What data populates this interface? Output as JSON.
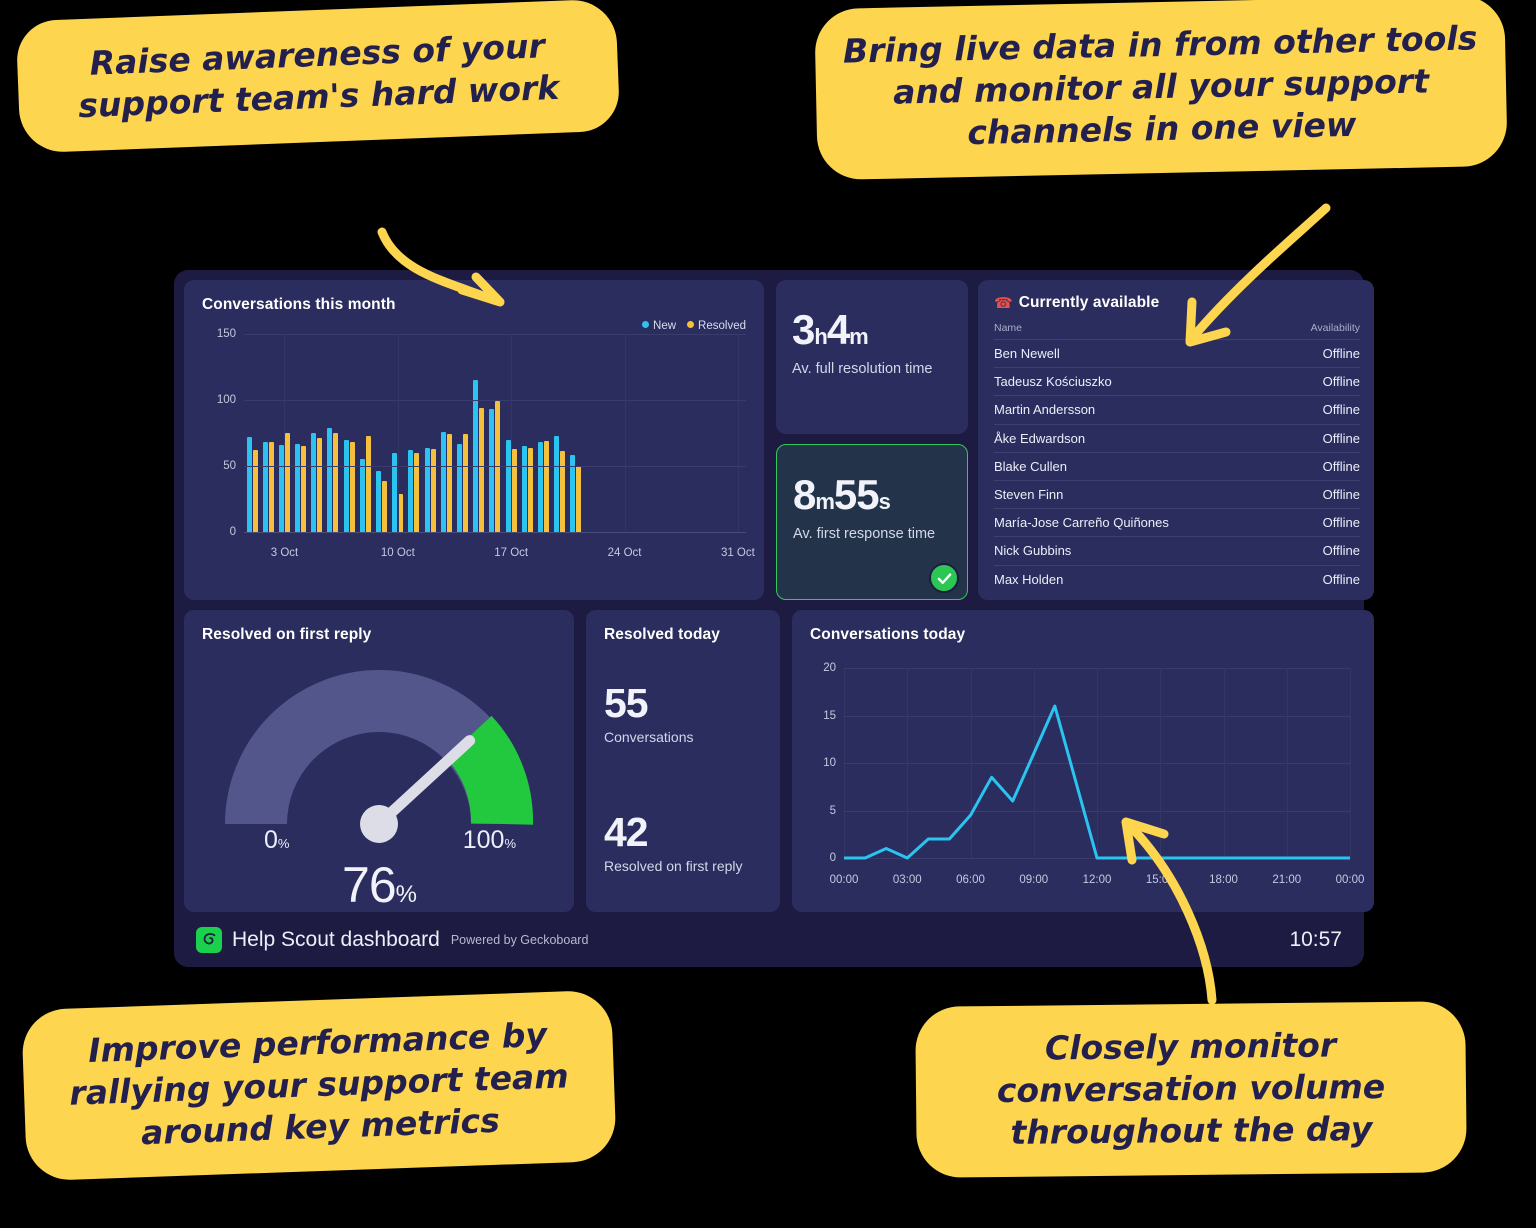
{
  "callouts": [
    {
      "id": "top-left",
      "text": "Raise awareness of your support team's hard work"
    },
    {
      "id": "top-right",
      "text": "Bring live data in from other tools and monitor all your support channels in one view"
    },
    {
      "id": "bottom-left",
      "text": "Improve performance by rallying your support team around key metrics"
    },
    {
      "id": "bottom-right",
      "text": "Closely monitor conversation volume throughout the day"
    }
  ],
  "dashboard": {
    "footer": {
      "logo_icon": "help-scout-logo-icon",
      "title": "Help Scout dashboard",
      "powered_by": "Powered by Geckoboard",
      "clock": "10:57"
    },
    "panels": {
      "conversations_month": {
        "title": "Conversations this month"
      },
      "full_resolution": {
        "value_main": "3",
        "value_main_unit": "h",
        "value_sec": "4",
        "value_sec_unit": "m",
        "label": "Av. full resolution time"
      },
      "first_response": {
        "value_main": "8",
        "value_main_unit": "m",
        "value_sec": "55",
        "value_sec_unit": "s",
        "label": "Av. first response time",
        "status_icon": "check-circle-icon",
        "status_color": "#2bc653"
      },
      "currently_available": {
        "emoji": "☎",
        "title": "Currently available",
        "columns": [
          "Name",
          "Availability"
        ],
        "rows": [
          [
            "Ben Newell",
            "Offline"
          ],
          [
            "Tadeusz Kościuszko",
            "Offline"
          ],
          [
            "Martin Andersson",
            "Offline"
          ],
          [
            "Åke Edwardson",
            "Offline"
          ],
          [
            "Blake Cullen",
            "Offline"
          ],
          [
            "Steven Finn",
            "Offline"
          ],
          [
            "María-Jose Carreño Quiñones",
            "Offline"
          ],
          [
            "Nick Gubbins",
            "Offline"
          ],
          [
            "Max Holden",
            "Offline"
          ]
        ]
      },
      "resolved_first_reply": {
        "title": "Resolved on first reply",
        "min_label": "0",
        "min_unit": "%",
        "max_label": "100",
        "max_unit": "%",
        "value": "76",
        "value_unit": "%"
      },
      "resolved_today": {
        "title": "Resolved today",
        "metric1_value": "55",
        "metric1_label": "Conversations",
        "metric2_value": "42",
        "metric2_label": "Resolved on first reply"
      },
      "conversations_today": {
        "title": "Conversations today"
      }
    }
  },
  "colors": {
    "brand_yellow": "#fdd54e",
    "series_new": "#2bc4f0",
    "series_resolved": "#f5c13d",
    "gauge_green": "#22c93f",
    "gauge_track": "#53568a",
    "panel_bg": "#2a2d5e",
    "dashboard_bg": "#1d1b42",
    "text": "#eceef8"
  },
  "chart_data": [
    {
      "type": "bar",
      "title": "Conversations this month",
      "xlabel": "",
      "ylabel": "",
      "ylim": [
        0,
        150
      ],
      "yticks": [
        0,
        50,
        100,
        150
      ],
      "grid": true,
      "legend": [
        "New",
        "Resolved"
      ],
      "legend_position": "top-right",
      "xtick_labels": [
        "3 Oct",
        "10 Oct",
        "17 Oct",
        "24 Oct",
        "31 Oct"
      ],
      "xtick_days": [
        3,
        10,
        17,
        24,
        31
      ],
      "days": [
        1,
        2,
        3,
        4,
        5,
        6,
        7,
        8,
        9,
        10,
        11,
        12,
        13,
        14,
        15,
        16,
        17,
        18,
        19,
        20,
        21,
        22
      ],
      "series": [
        {
          "name": "New",
          "color": "#2bc4f0",
          "values": [
            72,
            68,
            66,
            67,
            75,
            79,
            70,
            55,
            46,
            60,
            62,
            64,
            76,
            67,
            115,
            93,
            70,
            65,
            68,
            73,
            58,
            0
          ]
        },
        {
          "name": "Resolved",
          "color": "#f5c13d",
          "values": [
            62,
            68,
            75,
            65,
            71,
            75,
            68,
            73,
            39,
            29,
            60,
            63,
            74,
            74,
            94,
            99,
            63,
            64,
            69,
            61,
            50,
            0
          ]
        }
      ]
    },
    {
      "type": "line",
      "title": "Conversations today",
      "xlabel": "",
      "ylabel": "",
      "ylim": [
        0,
        20
      ],
      "yticks": [
        0,
        5,
        10,
        15,
        20
      ],
      "grid": true,
      "xtick_labels": [
        "00:00",
        "03:00",
        "06:00",
        "09:00",
        "12:00",
        "15:00",
        "18:00",
        "21:00",
        "00:00"
      ],
      "color": "#2bc4f0",
      "x": [
        0,
        1,
        2,
        3,
        4,
        5,
        6,
        7,
        8,
        9,
        10,
        11,
        12,
        13,
        14,
        15,
        16,
        17,
        18,
        19,
        20,
        21,
        22,
        23,
        24
      ],
      "values": [
        0,
        0,
        1,
        0,
        2,
        2,
        4.5,
        8.5,
        6,
        11,
        16,
        8,
        0,
        0,
        0,
        0,
        0,
        0,
        0,
        0,
        0,
        0,
        0,
        0,
        0
      ]
    },
    {
      "type": "gauge",
      "title": "Resolved on first reply",
      "value": 76,
      "min": 0,
      "max": 100,
      "unit": "%",
      "goal_band_start": 80,
      "goal_band_end": 100,
      "band_color": "#22c93f",
      "track_color": "#53568a"
    }
  ]
}
